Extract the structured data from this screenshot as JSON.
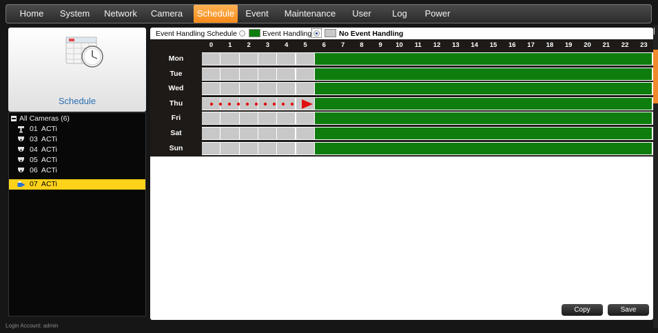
{
  "nav": {
    "tabs": [
      {
        "label": "Home",
        "active": false
      },
      {
        "label": "System",
        "active": false
      },
      {
        "label": "Network",
        "active": false
      },
      {
        "label": "Camera",
        "active": false
      },
      {
        "label": "Schedule",
        "active": true
      },
      {
        "label": "Event",
        "active": false
      },
      {
        "label": "Maintenance",
        "active": false
      },
      {
        "label": "User",
        "active": false
      },
      {
        "label": "Log",
        "active": false
      },
      {
        "label": "Power",
        "active": false
      }
    ]
  },
  "left": {
    "icon": "calendar-clock-icon",
    "title": "Schedule",
    "tree": {
      "root_label": "All Cameras (6)",
      "cameras": [
        {
          "id": "01",
          "name": "ACTi",
          "icon": "bullet-camera-icon",
          "selected": false
        },
        {
          "id": "03",
          "name": "ACTi",
          "icon": "dome-camera-icon",
          "selected": false
        },
        {
          "id": "04",
          "name": "ACTi",
          "icon": "dome-camera-icon",
          "selected": false
        },
        {
          "id": "05",
          "name": "ACTi",
          "icon": "dome-camera-icon",
          "selected": false
        },
        {
          "id": "06",
          "name": "ACTi",
          "icon": "dome-camera-icon",
          "selected": false
        },
        {
          "id": "07",
          "name": "ACTi",
          "icon": "box-camera-icon",
          "selected": true
        }
      ]
    }
  },
  "schedule": {
    "legend": {
      "title": "Event Handling Schedule",
      "on_label": "Event Handling",
      "off_label": "No Event Handling",
      "selected": "No Event Handling"
    },
    "hours": [
      "0",
      "1",
      "2",
      "3",
      "4",
      "5",
      "6",
      "7",
      "8",
      "9",
      "10",
      "11",
      "12",
      "13",
      "14",
      "15",
      "16",
      "17",
      "18",
      "19",
      "20",
      "21",
      "22",
      "23"
    ],
    "days": [
      "Mon",
      "Tue",
      "Wed",
      "Thu",
      "Fri",
      "Sat",
      "Sun"
    ],
    "event_handling_start_hour": 6,
    "event_handling_end_hour": 24,
    "colors": {
      "event_handling": "#0e7d0e",
      "no_event_handling": "#c8c8c8",
      "accent": "#f68a1a"
    }
  },
  "buttons": {
    "copy": "Copy",
    "save": "Save"
  },
  "footer": {
    "login": "Login Account: admin"
  }
}
